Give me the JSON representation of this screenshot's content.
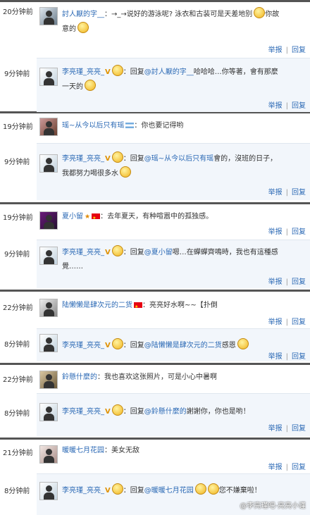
{
  "comments": [
    {
      "time": "20分钟前",
      "user": "討人厭的字__",
      "text_a": "：→_→说好的游泳呢? 泳衣和古装可是天差地别",
      "text_b": "你故",
      "text_c": "意的",
      "reply": {
        "time": "9分钟前",
        "user": "李亮瑾_亮亮_",
        "prefix": "：回复",
        "mention": "@討人厭的字__",
        "text_a": "哈哈哈…你等著，會有那麼",
        "text_b": "一天的"
      }
    },
    {
      "time": "19分钟前",
      "user": "瑶~从今以后只有瑶",
      "text_a": "：你也要记得哟",
      "reply": {
        "time": "9分钟前",
        "user": "李亮瑾_亮亮_",
        "prefix": "：回复",
        "mention": "@瑶~从今以后只有瑶",
        "text_a": "會的，沒班的日子，",
        "text_b": "我都努力喝很多水"
      }
    },
    {
      "time": "19分钟前",
      "user": "夏小留",
      "text_a": "：去年夏天，有种喧嚣中的孤独感。",
      "reply": {
        "time": "9分钟前",
        "user": "李亮瑾_亮亮_",
        "prefix": "：回复",
        "mention": "@夏小留",
        "text_a": "嗯…在蟬蟬齊鳴時，我也有這種感",
        "text_b": "覺……"
      }
    },
    {
      "time": "22分钟前",
      "user": "陆懒懒是肆次元的二货",
      "text_a": "：亮亮好水啊~~【扑倒",
      "reply": {
        "time": "8分钟前",
        "user": "李亮瑾_亮亮_",
        "prefix": "：回复",
        "mention": "@陆懒懒是肆次元的二货",
        "text_a": "感恩"
      }
    },
    {
      "time": "22分钟前",
      "user": "鈴懸什麼的",
      "text_a": "：我也喜欢这张照片，可是小心中暑啊",
      "reply": {
        "time": "8分钟前",
        "user": "李亮瑾_亮亮_",
        "prefix": "：回复",
        "mention": "@鈴懸什麼的",
        "text_a": "謝謝你，你也是喲！"
      }
    },
    {
      "time": "21分钟前",
      "user": "暖暖七月花园",
      "text_a": "：美女无敌",
      "reply": {
        "time": "8分钟前",
        "user": "李亮瑾_亮亮_",
        "prefix": "：回复",
        "mention": "@暖暖七月花园",
        "text_a": "您不嫌棄啦！"
      }
    }
  ],
  "actions": {
    "report": "举报",
    "reply": "回复"
  },
  "watermark": "@李亮瑾吧-亮亮小谨",
  "colors": {
    "link": "#2b69b5",
    "reply_bg": "#f2f6fb",
    "separator": "#555555"
  }
}
